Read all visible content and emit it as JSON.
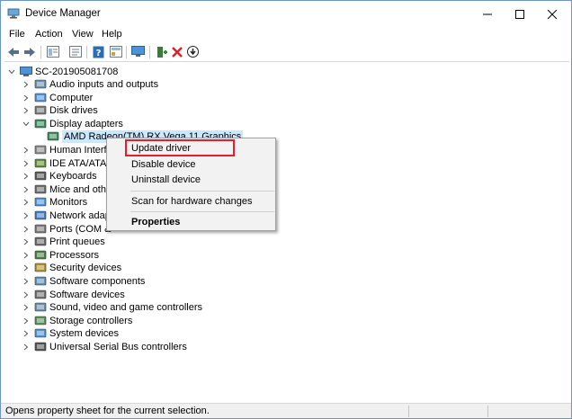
{
  "window": {
    "title": "Device Manager"
  },
  "menu": [
    "File",
    "Action",
    "View",
    "Help"
  ],
  "toolbar": {
    "icons": [
      "back-arrow-icon",
      "forward-arrow-icon",
      "properties-icon",
      "properties-sheet-icon",
      "help-icon",
      "show-hidden-icon",
      "monitor-icon",
      "add-driver-icon",
      "uninstall-x-icon",
      "update-download-icon"
    ]
  },
  "tree": {
    "root": "SC-201905081708",
    "items": [
      {
        "label": "Audio inputs and outputs",
        "icon": "speaker-icon"
      },
      {
        "label": "Computer",
        "icon": "computer-icon"
      },
      {
        "label": "Disk drives",
        "icon": "disk-icon"
      },
      {
        "label": "Display adapters",
        "icon": "display-adapter-icon",
        "expanded": true
      },
      {
        "label": "AMD Radeon(TM) RX Vega 11 Graphics",
        "icon": "display-adapter-icon",
        "child": true,
        "selected": true
      },
      {
        "label": "Human Interfa",
        "icon": "hid-icon"
      },
      {
        "label": "IDE ATA/ATAPI",
        "icon": "ide-icon"
      },
      {
        "label": "Keyboards",
        "icon": "keyboard-icon"
      },
      {
        "label": "Mice and othe",
        "icon": "mouse-icon"
      },
      {
        "label": "Monitors",
        "icon": "monitor-icon"
      },
      {
        "label": "Network adapt",
        "icon": "network-icon"
      },
      {
        "label": "Ports (COM &",
        "icon": "port-icon"
      },
      {
        "label": "Print queues",
        "icon": "printer-icon"
      },
      {
        "label": "Processors",
        "icon": "processor-icon"
      },
      {
        "label": "Security devices",
        "icon": "security-icon"
      },
      {
        "label": "Software components",
        "icon": "software-component-icon"
      },
      {
        "label": "Software devices",
        "icon": "software-device-icon"
      },
      {
        "label": "Sound, video and game controllers",
        "icon": "sound-icon"
      },
      {
        "label": "Storage controllers",
        "icon": "storage-icon"
      },
      {
        "label": "System devices",
        "icon": "system-icon"
      },
      {
        "label": "Universal Serial Bus controllers",
        "icon": "usb-icon"
      }
    ]
  },
  "context_menu": {
    "items": [
      "Update driver",
      "Disable device",
      "Uninstall device",
      "Scan for hardware changes",
      "Properties"
    ],
    "highlighted": "Update driver"
  },
  "statusbar": {
    "text": "Opens property sheet for the current selection."
  },
  "colors": {
    "selection": "#cce8ff",
    "highlight_border": "#e0202a",
    "menu_bg": "#f2f2f2"
  }
}
